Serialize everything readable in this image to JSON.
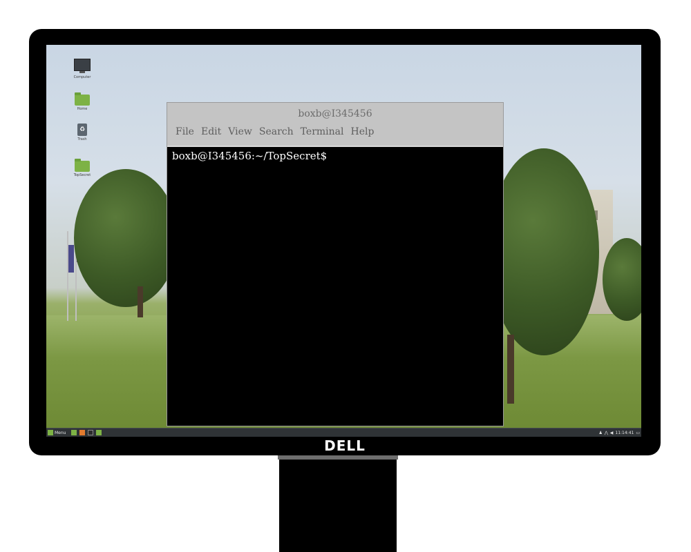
{
  "monitor": {
    "brand": "DELL"
  },
  "desktop": {
    "icons": [
      {
        "label": "Computer",
        "icon": "computer-icon"
      },
      {
        "label": "Home",
        "icon": "home-folder-icon"
      },
      {
        "label": "Trash",
        "icon": "trash-icon"
      },
      {
        "label": "TopSecret",
        "icon": "folder-icon"
      }
    ]
  },
  "terminal": {
    "title": "boxb@I345456",
    "menu": [
      "File",
      "Edit",
      "View",
      "Search",
      "Terminal",
      "Help"
    ],
    "prompt": "boxb@I345456:~/TopSecret$"
  },
  "taskbar": {
    "menu_label": "Menu",
    "clock": "11:14:41"
  },
  "colors": {
    "terminal_bg": "#000000",
    "terminal_text": "#ffffff",
    "titlebar": "#c4c4c4",
    "folder_green": "#7db245",
    "taskbar": "#2f3336"
  }
}
